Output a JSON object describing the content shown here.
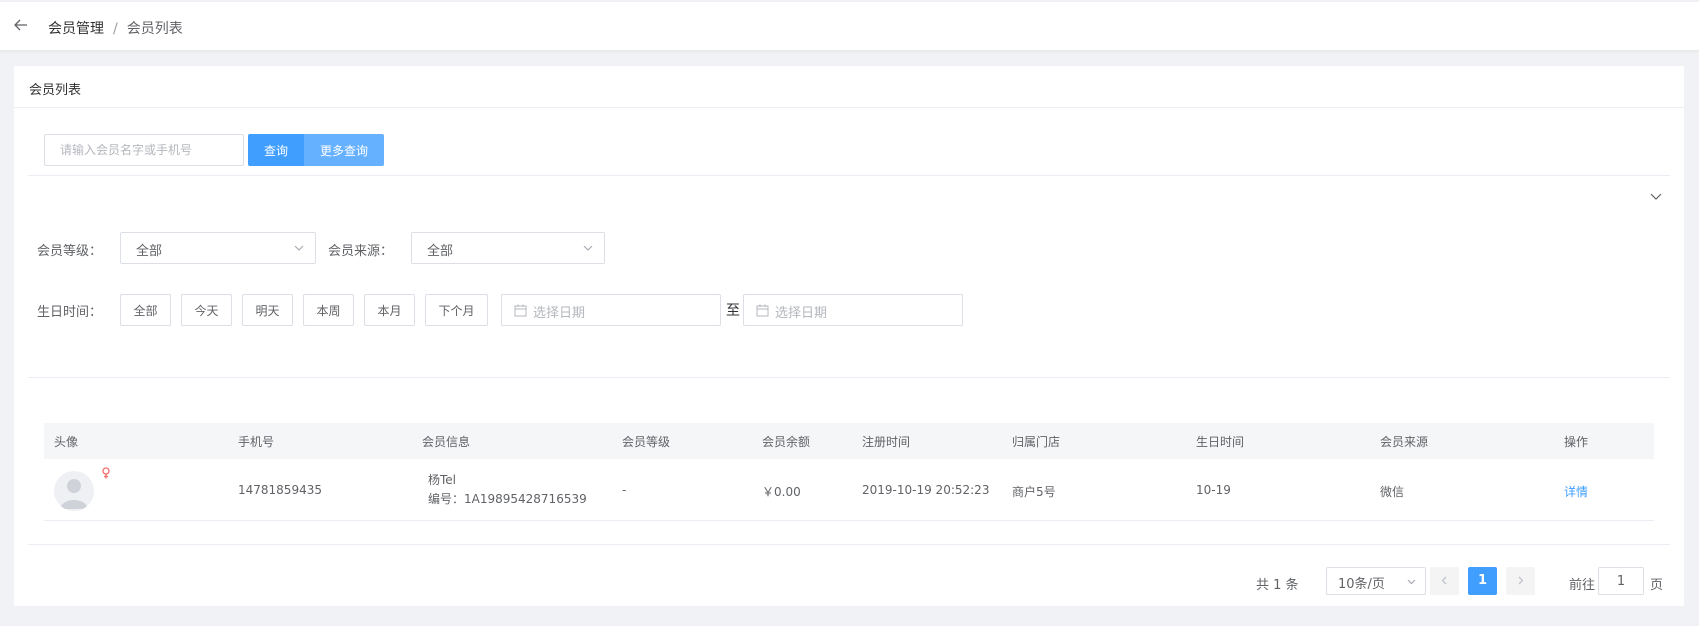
{
  "breadcrumb": {
    "parent": "会员管理",
    "separator": "/",
    "current": "会员列表"
  },
  "card": {
    "title": "会员列表"
  },
  "search": {
    "placeholder": "请输入会员名字或手机号",
    "query_button": "查询",
    "more_button": "更多查询"
  },
  "filters": {
    "level_label": "会员等级：",
    "level_value": "全部",
    "source_label": "会员来源：",
    "source_value": "全部",
    "birthday_label": "生日时间：",
    "birthday_options": [
      "全部",
      "今天",
      "明天",
      "本周",
      "本月",
      "下个月"
    ],
    "date_placeholder": "选择日期",
    "range_separator": "至"
  },
  "table": {
    "columns": [
      "头像",
      "手机号",
      "会员信息",
      "会员等级",
      "会员余额",
      "注册时间",
      "归属门店",
      "生日时间",
      "会员来源",
      "操作"
    ],
    "rows": [
      {
        "gender_icon": "female-icon",
        "phone": "14781859435",
        "name": "杨Tel",
        "member_no": "编号：1A19895428716539",
        "level": "-",
        "balance": "￥0.00",
        "register_time": "2019-10-19 20:52:23",
        "store": "商户5号",
        "birthday": "10-19",
        "source": "微信",
        "action": "详情"
      }
    ]
  },
  "pagination": {
    "total": "共 1 条",
    "page_size": "10条/页",
    "current_page": "1",
    "goto_label": "前往",
    "goto_value": "1",
    "page_suffix": "页"
  },
  "colors": {
    "primary": "#409eff",
    "primary_light": "#66b1ff",
    "female": "#f56c6c",
    "header_bg": "#f5f6f8"
  }
}
